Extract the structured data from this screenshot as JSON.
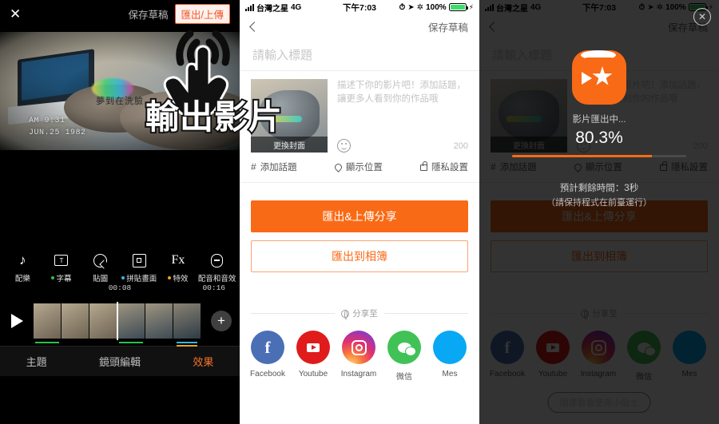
{
  "annotation": {
    "label": "輸出影片",
    "hand_icon": "tap-hand-icon"
  },
  "status_bar": {
    "carrier": "台灣之星",
    "network": "4G",
    "time": "下午7:03",
    "battery_pct": "100%",
    "icons": [
      "signal-bars-icon",
      "alarm-icon",
      "location-arrow-icon",
      "bluetooth-icon",
      "battery-icon",
      "charging-bolt-icon"
    ]
  },
  "panel1": {
    "close_label": "✕",
    "save_draft": "保存草稿",
    "export_button": "匯出/上傳",
    "preview": {
      "subtitle": "夢到在洗臉",
      "stamp_time": "AM 9:31",
      "stamp_date": "JUN.25 1982"
    },
    "tools": [
      {
        "label": "配樂",
        "icon": "music-note-icon",
        "dot": ""
      },
      {
        "label": "字幕",
        "icon": "text-box-icon",
        "dot": "#2bc24a"
      },
      {
        "label": "貼圖",
        "icon": "sticker-icon",
        "dot": ""
      },
      {
        "label": "拼貼畫面",
        "icon": "collage-icon",
        "dot": "#35b6e8"
      },
      {
        "label": "特效",
        "icon": "fx-icon",
        "dot": "#f0a21a"
      },
      {
        "label": "配音和音效",
        "icon": "microphone-icon",
        "dot": ""
      }
    ],
    "timeline": {
      "current": "00:08",
      "total": "00:16",
      "play_icon": "play-icon",
      "add_icon": "plus-icon"
    },
    "tabs": [
      {
        "label": "主題",
        "active": false
      },
      {
        "label": "鏡頭編輯",
        "active": false
      },
      {
        "label": "效果",
        "active": true
      }
    ]
  },
  "panel2": {
    "back_icon": "chevron-left-icon",
    "save_draft": "保存草稿",
    "title_placeholder": "請輸入標題",
    "desc_placeholder": "描述下你的影片吧！添加話題，讓更多人看到你的作品哦",
    "cover_label": "更換封面",
    "emoji_icon": "smiley-icon",
    "char_count": "200",
    "meta": [
      {
        "label": "添加話題",
        "icon": "hashtag-icon"
      },
      {
        "label": "顯示位置",
        "icon": "location-pin-icon"
      },
      {
        "label": "隱私設置",
        "icon": "lock-icon"
      }
    ],
    "primary_button": "匯出&上傳分享",
    "ghost_button": "匯出到相簿",
    "share_to": "分享至",
    "share_icon": "globe-icon",
    "socials": [
      {
        "name": "Facebook",
        "icon": "facebook-icon",
        "glyph": "f"
      },
      {
        "name": "Youtube",
        "icon": "youtube-icon",
        "glyph": ""
      },
      {
        "name": "Instagram",
        "icon": "instagram-icon",
        "glyph": ""
      },
      {
        "name": "微信",
        "icon": "wechat-icon",
        "glyph": ""
      },
      {
        "name": "Mes",
        "icon": "messenger-icon",
        "glyph": ""
      }
    ]
  },
  "panel3": {
    "close_icon": "close-circle-icon",
    "logo_icon": "vivavideo-logo-icon",
    "exporting_label": "影片匯出中...",
    "percent_label": "80.3%",
    "progress_pct": 80.3,
    "eta_line1": "預計剩餘時間：3秒",
    "eta_line2": "（請保持程式在前臺運行）",
    "tip_button": "順便看看使用小貼士",
    "accent_color": "#f96a16"
  }
}
